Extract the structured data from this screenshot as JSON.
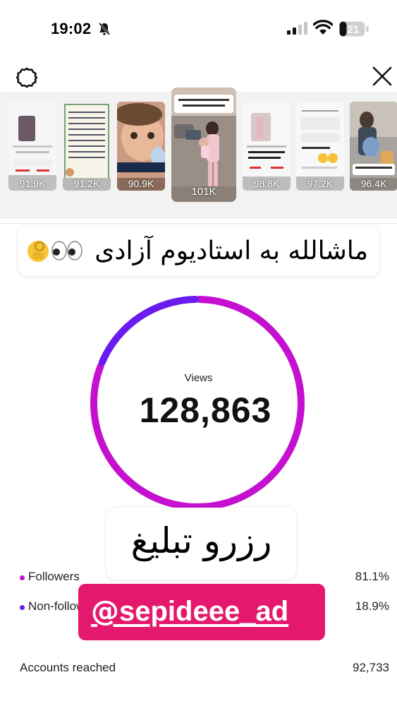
{
  "status_bar": {
    "time": "19:02",
    "battery": "21"
  },
  "stories": [
    {
      "views": "91.9K"
    },
    {
      "views": "91.2K"
    },
    {
      "views": "90.9K"
    },
    {
      "views": "101K",
      "selected": true
    },
    {
      "views": "98.8K"
    },
    {
      "views": "97.2K"
    },
    {
      "views": "96.4K"
    }
  ],
  "stickers": {
    "caption": "ماشالله به استادیوم آزادی",
    "caption_emoji": "👌👀👀",
    "promo": "رزرو تبلیغ",
    "handle": "sepideee_ad"
  },
  "insights": {
    "views_label": "Views",
    "views_total": "128,863",
    "followers_label": "Followers",
    "followers_pct": "81.1%",
    "nonfollowers_label": "Non-followers",
    "nonfollowers_pct": "18.9%",
    "accounts_reached_label": "Accounts reached",
    "accounts_reached": "92,733"
  },
  "chart_data": {
    "type": "pie",
    "categories": [
      "Followers",
      "Non-followers"
    ],
    "values": [
      81.1,
      18.9
    ],
    "title": "Views",
    "total": "128,863"
  },
  "colors": {
    "followers": "#c511cf",
    "non_followers": "#6a1cf0",
    "handle_sticker": "#e4186c"
  }
}
